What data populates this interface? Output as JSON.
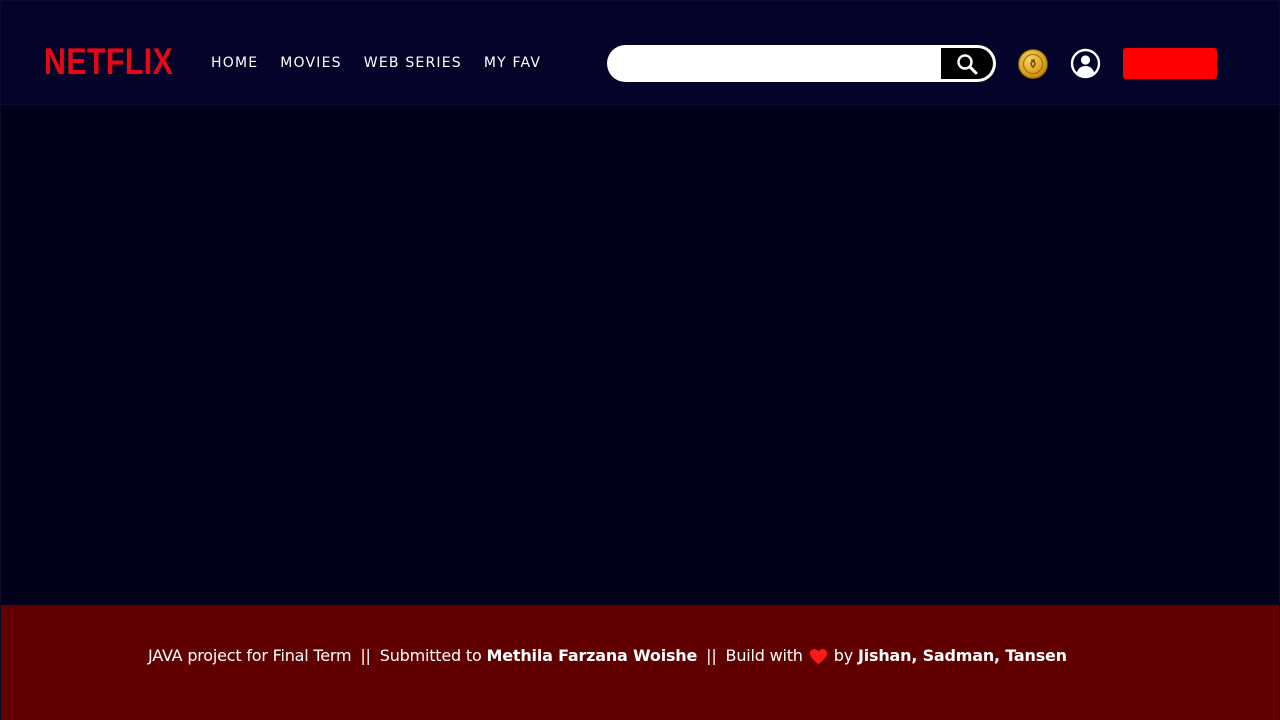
{
  "header": {
    "logo_text": "NETFLIX",
    "nav": [
      {
        "label": "HOME"
      },
      {
        "label": "MOVIES"
      },
      {
        "label": "WEB SERIES"
      },
      {
        "label": "MY FAV"
      }
    ],
    "search": {
      "placeholder": "",
      "value": "",
      "icon": "search-icon"
    },
    "coin_icon": "gold-coin-icon",
    "profile_icon": "user-circle-icon",
    "red_button_label": ""
  },
  "footer": {
    "part1": "JAVA project for Final Term",
    "separator": "||",
    "part2_prefix": "Submitted to",
    "part2_name": "Methila Farzana Woishe",
    "part3_prefix": "Build with",
    "heart_icon": "heart-icon",
    "part3_by": "by",
    "authors": "Jishan, Sadman, Tansen"
  },
  "colors": {
    "background": "#00001a",
    "header_bg": "#04042a",
    "brand_red": "#e50914",
    "button_red": "#ff0000",
    "footer_bg": "#610000",
    "heart": "#ff1a1a"
  }
}
